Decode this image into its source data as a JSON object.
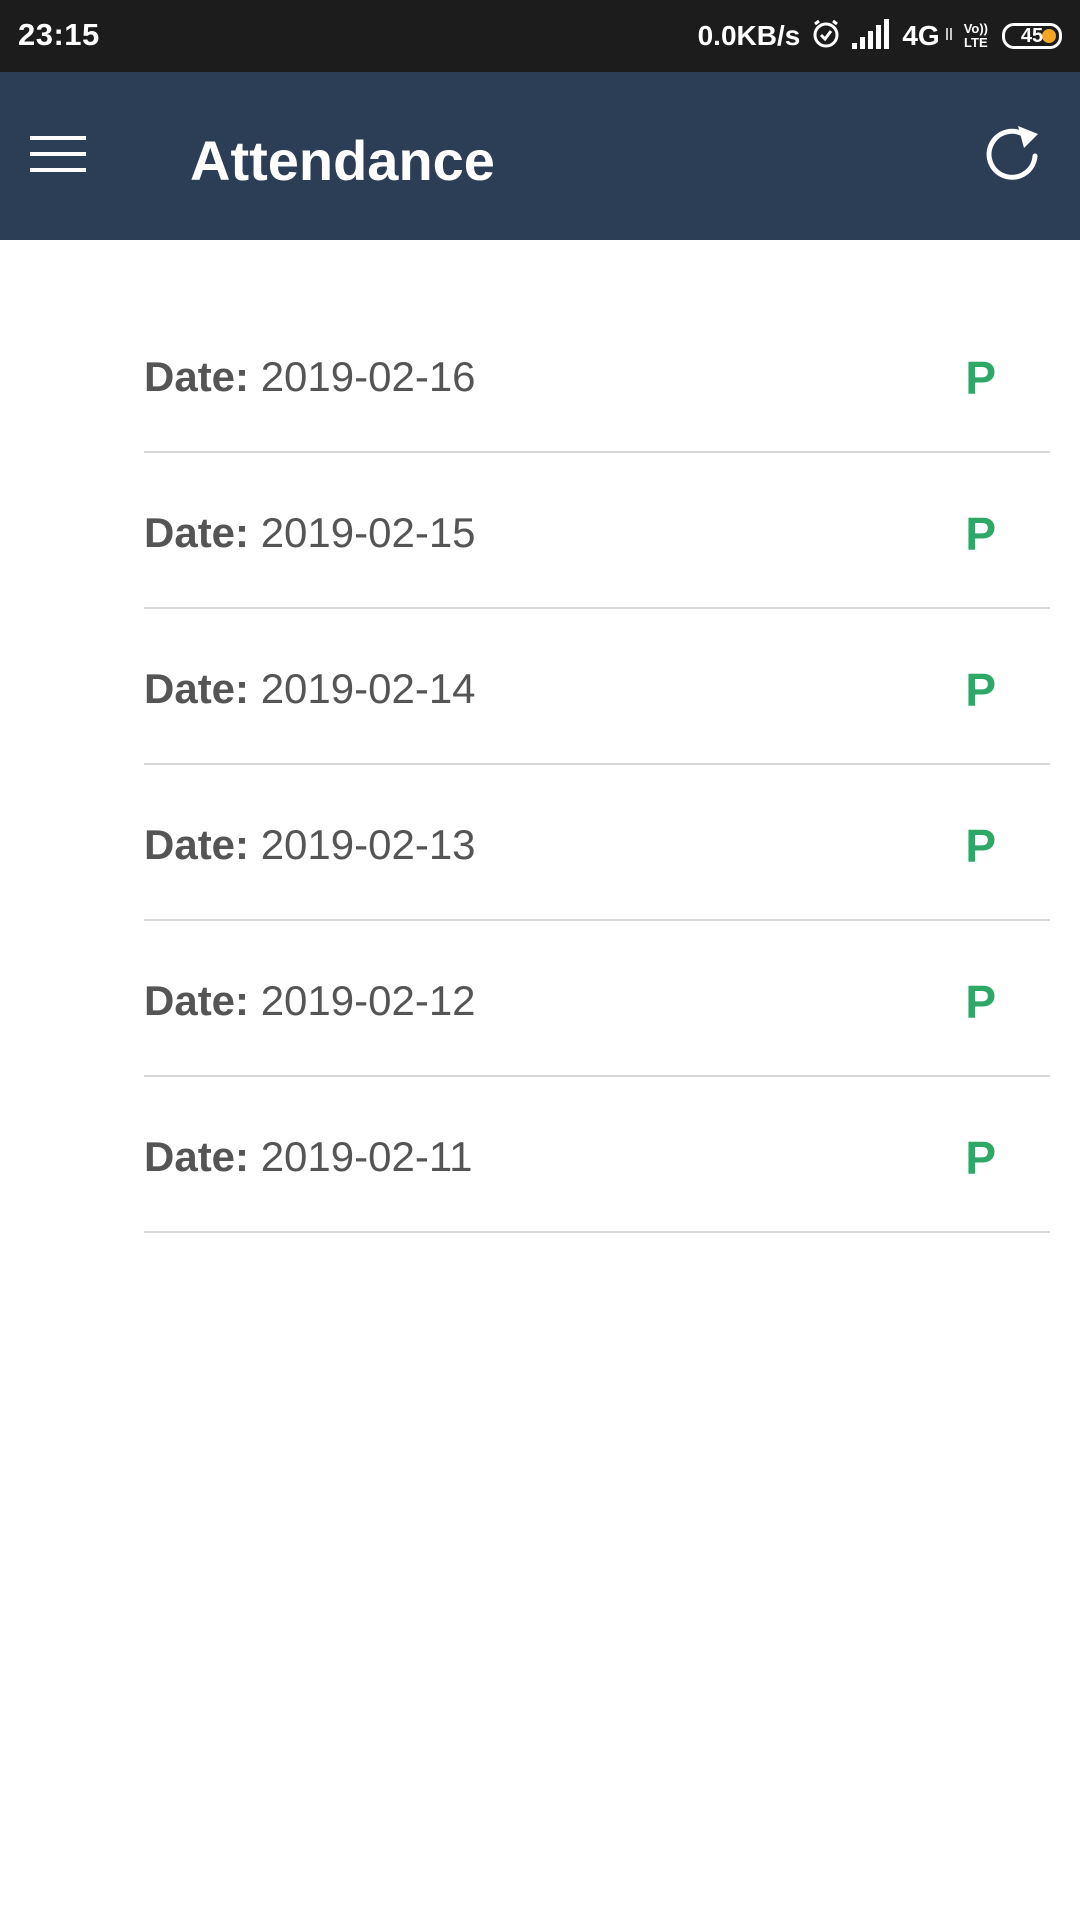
{
  "status_bar": {
    "time": "23:15",
    "net_speed": "0.0KB/s",
    "network": "4G",
    "volte_top": "Vo))",
    "volte_bottom": "LTE",
    "battery": "45",
    "battery_accent": "#f5a623"
  },
  "app_bar": {
    "title": "Attendance",
    "menu_icon": "hamburger-menu-icon",
    "refresh_icon": "refresh-icon",
    "background": "#2c3e56"
  },
  "attendance": {
    "status_color": "#2ea866",
    "rows": [
      {
        "label": "Date:",
        "date": "2019-02-16",
        "status": "P"
      },
      {
        "label": "Date:",
        "date": "2019-02-15",
        "status": "P"
      },
      {
        "label": "Date:",
        "date": "2019-02-14",
        "status": "P"
      },
      {
        "label": "Date:",
        "date": "2019-02-13",
        "status": "P"
      },
      {
        "label": "Date:",
        "date": "2019-02-12",
        "status": "P"
      },
      {
        "label": "Date:",
        "date": "2019-02-11",
        "status": "P"
      }
    ]
  }
}
